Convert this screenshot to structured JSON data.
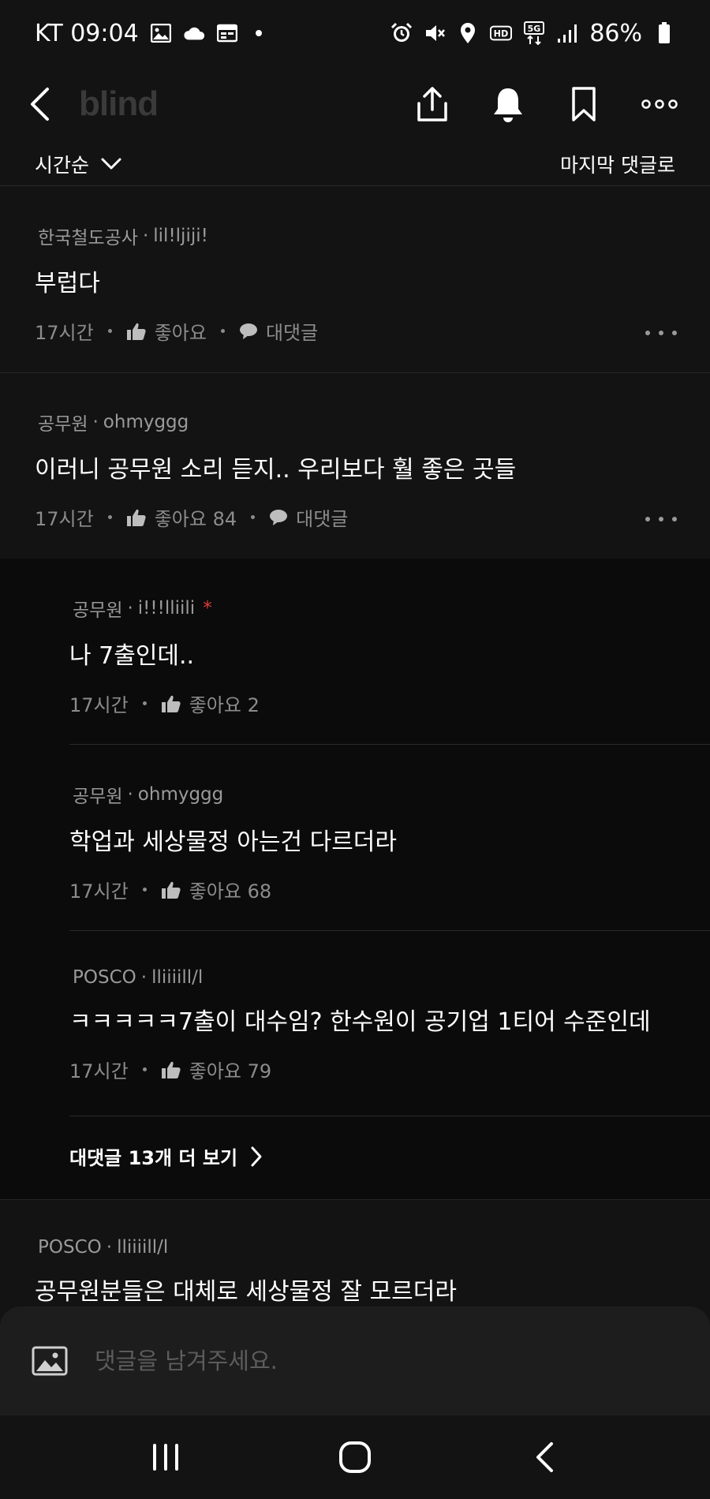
{
  "status_bar": {
    "carrier_time": "KT 09:04",
    "battery": "86%"
  },
  "app": {
    "logo": "blind"
  },
  "sort": {
    "selected": "시간순",
    "last_comment_link": "마지막 댓글로"
  },
  "comments": [
    {
      "company": "한국철도공사",
      "nickname": "lil!ljiji!",
      "body": "부럽다",
      "time": "17시간",
      "like_label": "좋아요",
      "reply_label": "대댓글"
    },
    {
      "company": "공무원",
      "nickname": "ohmyggg",
      "body": "이러니 공무원 소리 듣지.. 우리보다 훨 좋은 곳들",
      "time": "17시간",
      "like_label": "좋아요 84",
      "reply_label": "대댓글"
    }
  ],
  "replies": [
    {
      "company": "공무원",
      "nickname": "i!!!lliili",
      "badge": "*",
      "body": "나 7출인데..",
      "time": "17시간",
      "like_label": "좋아요 2"
    },
    {
      "company": "공무원",
      "nickname": "ohmyggg",
      "body": "학업과 세상물정 아는건 다르더라",
      "time": "17시간",
      "like_label": "좋아요 68"
    },
    {
      "company": "POSCO",
      "nickname": "lliiiill/l",
      "body": "ㅋㅋㅋㅋㅋ7출이 대수임? 한수원이 공기업 1티어 수준인데",
      "time": "17시간",
      "like_label": "좋아요 79"
    }
  ],
  "more_replies": "대댓글 13개 더 보기",
  "last_comment": {
    "company": "POSCO",
    "nickname": "lliiiill/l",
    "body": "공무원분들은 대체로 세상물정 잘 모르더라"
  },
  "input": {
    "placeholder": "댓글을 남겨주세요."
  },
  "colors": {
    "background": "#131313",
    "reply_background": "#0b0b0b",
    "input_background": "#1d1d1d",
    "muted_text": "#9a9a9a",
    "badge_red": "#e03c3c"
  }
}
